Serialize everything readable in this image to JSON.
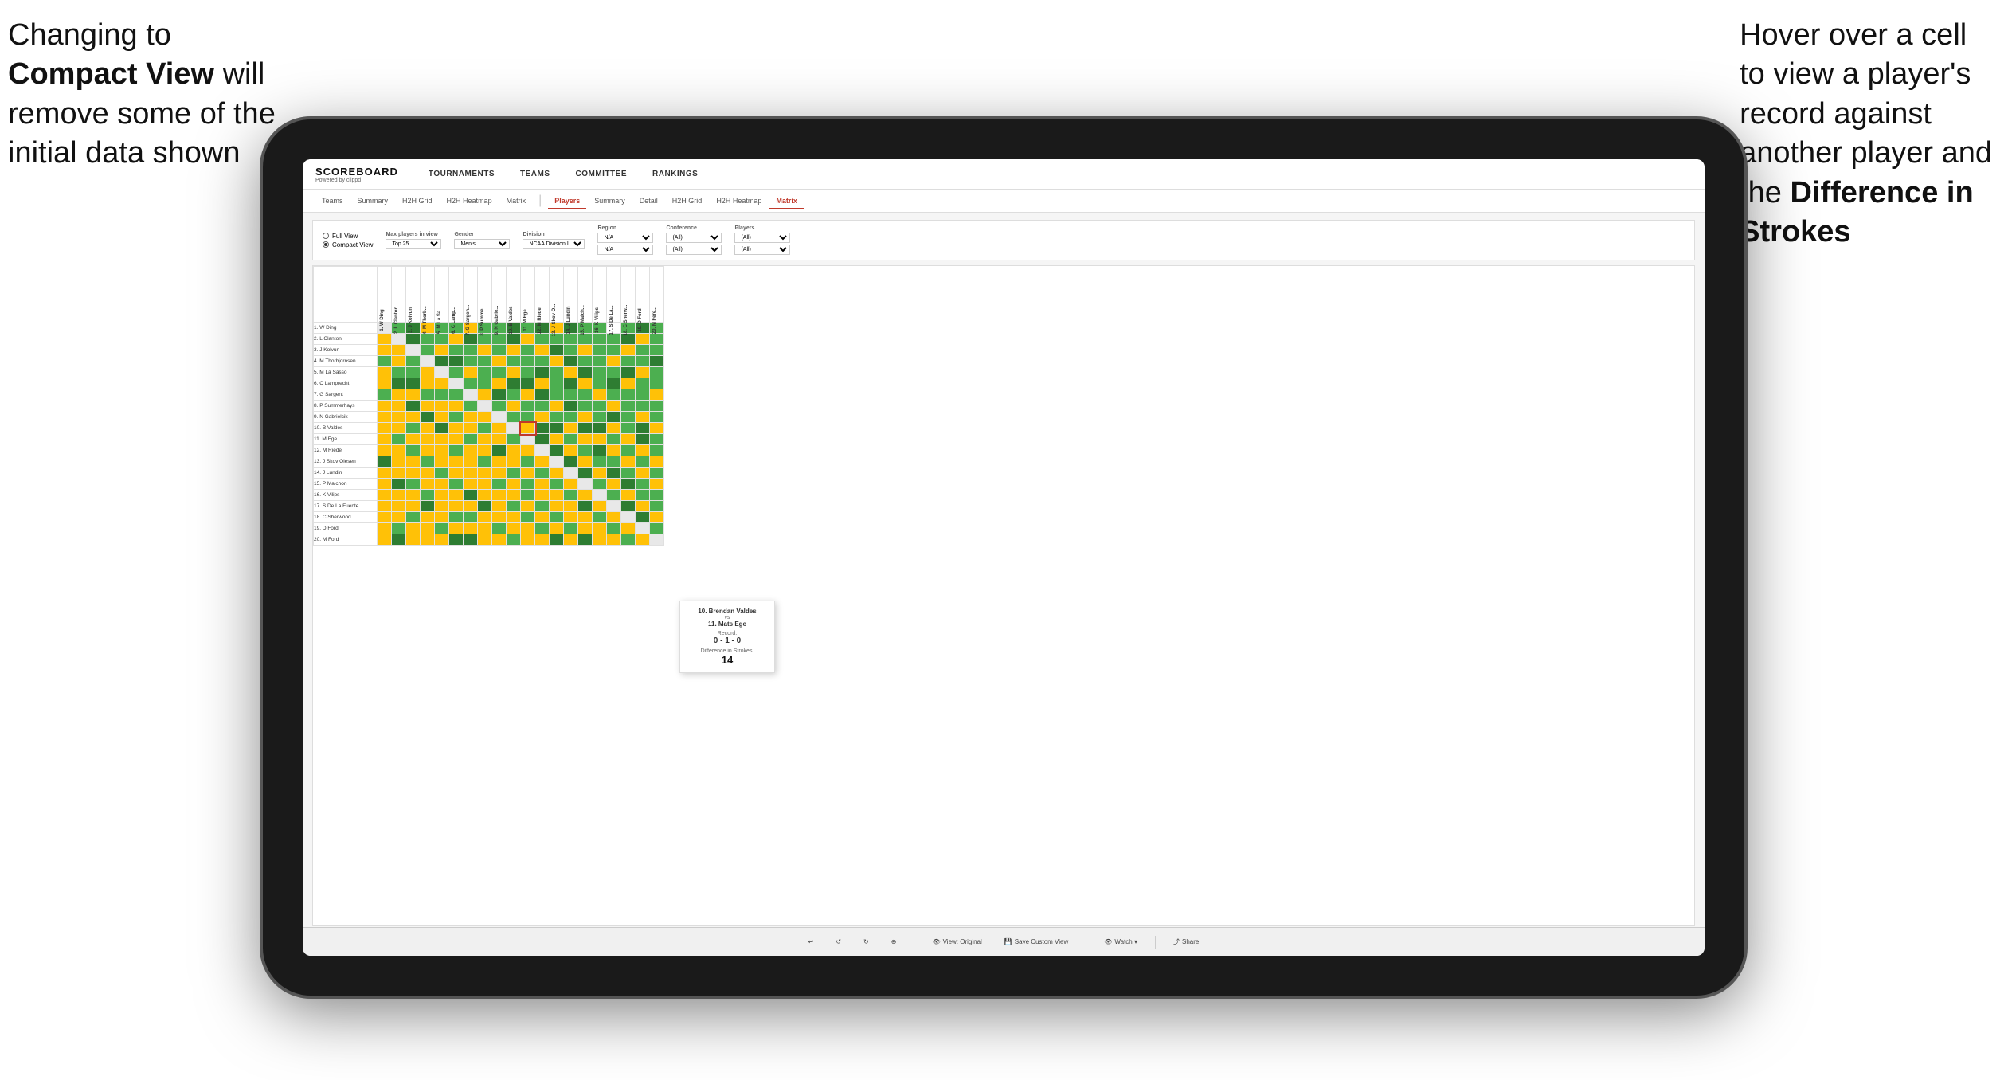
{
  "annotation_left": {
    "line1": "Changing to",
    "line2_bold": "Compact View",
    "line2_rest": " will",
    "line3": "remove some of the",
    "line4": "initial data shown"
  },
  "annotation_right": {
    "line1": "Hover over a cell",
    "line2": "to view a player's",
    "line3": "record against",
    "line4": "another player and",
    "line5_pre": "the ",
    "line5_bold": "Difference in",
    "line6_bold": "Strokes"
  },
  "nav": {
    "logo": "SCOREBOARD",
    "logo_sub": "Powered by clippd",
    "items": [
      "TOURNAMENTS",
      "TEAMS",
      "COMMITTEE",
      "RANKINGS"
    ]
  },
  "sub_tabs": {
    "section1": [
      "Teams",
      "Summary",
      "H2H Grid",
      "H2H Heatmap",
      "Matrix"
    ],
    "section2_active": "Players",
    "section2": [
      "Players",
      "Summary",
      "Detail",
      "H2H Grid",
      "H2H Heatmap",
      "Matrix"
    ]
  },
  "filters": {
    "view_options": [
      "Full View",
      "Compact View"
    ],
    "selected_view": "Compact View",
    "max_players": "Top 25",
    "gender": "Men's",
    "division": "NCAA Division I",
    "region_label": "Region",
    "region1": "N/A",
    "region2": "N/A",
    "conference_label": "Conference",
    "conference1": "(All)",
    "conference2": "(All)",
    "players_label": "Players",
    "players1": "(All)",
    "players2": "(All)"
  },
  "players": [
    "1. W Ding",
    "2. L Clanton",
    "3. J Kolvun",
    "4. M Thorbjornsen",
    "5. M La Sasso",
    "6. C Lamprecht",
    "7. G Sargent",
    "8. P Summerhays",
    "9. N Gabrielcik",
    "10. B Valdes",
    "11. M Ege",
    "12. M Riedel",
    "13. J Skov Olesen",
    "14. J Lundin",
    "15. P Maichon",
    "16. K Vilips",
    "17. S De La Fuente",
    "18. C Sherwood",
    "19. D Ford",
    "20. M Ford"
  ],
  "col_headers": [
    "1. W Ding",
    "2. L Clanton",
    "3. J Kolvun",
    "4. M Thorb...",
    "5. M La Sa...",
    "6. C Lamp...",
    "7. G Sargen...",
    "8. P Summe...",
    "9. N Gabrie...",
    "10. B Valdes",
    "11. M Ege",
    "12. M Riedel",
    "13. J Skov O...",
    "14. J Lundin",
    "15. P Maich...",
    "16. K Vilips",
    "17. S De La...",
    "18. C Sherw...",
    "19. D Ford",
    "20. M Fere..."
  ],
  "tooltip": {
    "player1": "10. Brendan Valdes",
    "vs": "vs",
    "player2": "11. Mats Ege",
    "record_label": "Record:",
    "record": "0 - 1 - 0",
    "diff_label": "Difference in Strokes:",
    "diff": "14"
  },
  "toolbar": {
    "undo": "↩",
    "redo": "↪",
    "view_original": "View: Original",
    "save_custom": "Save Custom View",
    "watch": "Watch ▾",
    "share": "Share"
  }
}
